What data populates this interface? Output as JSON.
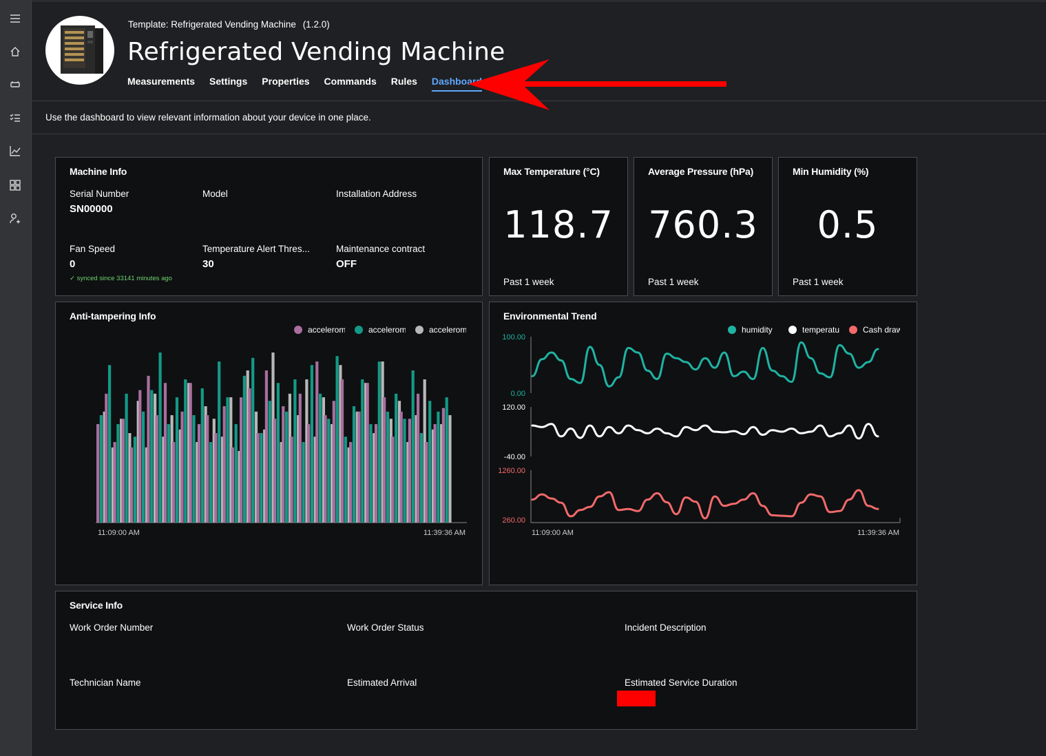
{
  "rail": {
    "icons": [
      "hamburger-icon",
      "home-icon",
      "device-icon",
      "rules-icon",
      "analytics-icon",
      "dashboard-icon",
      "admin-icon"
    ]
  },
  "header": {
    "template_prefix": "Template:",
    "template_name": "Refrigerated Vending Machine",
    "template_version": "(1.2.0)",
    "title": "Refrigerated Vending Machine",
    "tabs": [
      {
        "label": "Measurements"
      },
      {
        "label": "Settings"
      },
      {
        "label": "Properties"
      },
      {
        "label": "Commands"
      },
      {
        "label": "Rules"
      },
      {
        "label": "Dashboard",
        "active": true
      }
    ]
  },
  "description": "Use the dashboard to view relevant information about your device in one place.",
  "machine_info": {
    "title": "Machine Info",
    "serial_label": "Serial Number",
    "serial_value": "SN00000",
    "model_label": "Model",
    "address_label": "Installation Address",
    "fan_label": "Fan Speed",
    "fan_value": "0",
    "synced_text": "✓ synced since 33141 minutes ago",
    "temp_alert_label": "Temperature Alert Thres...",
    "temp_alert_value": "30",
    "maintenance_label": "Maintenance contract",
    "maintenance_value": "OFF"
  },
  "kpis": [
    {
      "title": "Max Temperature (°C)",
      "value": "118.7",
      "period": "Past 1 week"
    },
    {
      "title": "Average Pressure (hPa)",
      "value": "760.3",
      "period": "Past 1 week"
    },
    {
      "title": "Min Humidity (%)",
      "value": "0.5",
      "period": "Past 1 week"
    }
  ],
  "colors": {
    "accent": "#5fa8ff",
    "magenta": "#a86e9e",
    "teal": "#139a86",
    "grey": "#b8b8b8",
    "humidity": "#1fb3a3",
    "temperature": "#ffffff",
    "cash": "#f26a6a",
    "arrow": "#ff0000"
  },
  "anti_tamper": {
    "title": "Anti-tampering Info",
    "legend": [
      "acceleromet",
      "acceleromet",
      "acceleromet"
    ],
    "x_start": "11:09:00 AM",
    "x_end": "11:39:36 AM"
  },
  "env_trend": {
    "title": "Environmental Trend",
    "legend": [
      "humidity",
      "temperature",
      "Cash drawer"
    ],
    "x_start": "11:09:00 AM",
    "x_end": "11:39:36 AM",
    "humidity_max": "100.00",
    "humidity_min": "0.00",
    "temp_max": "120.00",
    "temp_min": "-40.00",
    "cash_max": "1260.00",
    "cash_min": "260.00"
  },
  "service_info": {
    "title": "Service Info",
    "work_order_number": "Work Order Number",
    "work_order_status": "Work Order Status",
    "incident_description": "Incident Description",
    "technician_name": "Technician Name",
    "estimated_arrival": "Estimated Arrival",
    "estimated_duration": "Estimated Service Duration"
  },
  "chart_data": [
    {
      "type": "bar",
      "title": "Anti-tampering Info",
      "x": [
        "11:09:00 AM",
        "11:39:36 AM"
      ],
      "series": [
        {
          "name": "acceleromet",
          "values": [
            0.55,
            0.72,
            0.45,
            0.58,
            0.42,
            0.74,
            0.82,
            0.6,
            0.78,
            0.45,
            0.62,
            0.78,
            0.55,
            0.6,
            0.5,
            0.65,
            0.42,
            0.7,
            0.75,
            0.5,
            0.85,
            0.58,
            0.65,
            0.48,
            0.72,
            0.55,
            0.9,
            0.6,
            0.68,
            0.8,
            0.45,
            0.62,
            0.78,
            0.55,
            0.7,
            0.48,
            0.62,
            0.58,
            0.72,
            0.45,
            0.55,
            0.64
          ]
        },
        {
          "name": "acceleromet",
          "values": [
            0.6,
            0.88,
            0.55,
            0.72,
            0.48,
            0.62,
            0.74,
            0.95,
            0.55,
            0.7,
            0.8,
            0.6,
            0.75,
            0.45,
            0.9,
            0.7,
            0.55,
            0.82,
            0.92,
            0.5,
            0.68,
            0.78,
            0.62,
            0.8,
            0.45,
            0.88,
            0.72,
            0.58,
            0.93,
            0.48,
            0.65,
            0.8,
            0.55,
            0.9,
            0.62,
            0.72,
            0.58,
            0.85,
            0.5,
            0.68,
            0.62,
            0.7
          ]
        },
        {
          "name": "acceleromet",
          "values": [
            0.62,
            0.42,
            0.58,
            0.5,
            0.68,
            0.42,
            0.72,
            0.48,
            0.6,
            0.52,
            0.78,
            0.45,
            0.65,
            0.58,
            0.48,
            0.7,
            0.4,
            0.85,
            0.62,
            0.52,
            0.95,
            0.45,
            0.72,
            0.6,
            0.8,
            0.48,
            0.7,
            0.55,
            0.88,
            0.42,
            0.62,
            0.78,
            0.5,
            0.9,
            0.58,
            0.68,
            0.45,
            0.6,
            0.8,
            0.52,
            0.55,
            0.6
          ]
        }
      ]
    },
    {
      "type": "line",
      "title": "Environmental Trend",
      "x": [
        "11:09:00 AM",
        "11:39:36 AM"
      ],
      "series": [
        {
          "name": "humidity",
          "ylim": [
            0,
            100
          ],
          "values": [
            30,
            60,
            72,
            58,
            25,
            18,
            82,
            50,
            12,
            28,
            80,
            72,
            40,
            25,
            70,
            62,
            55,
            42,
            62,
            45,
            72,
            30,
            38,
            25,
            80,
            40,
            30,
            20,
            90,
            62,
            35,
            28,
            85,
            70,
            45,
            55,
            78
          ]
        },
        {
          "name": "temperature",
          "ylim": [
            -40,
            120
          ],
          "values": [
            60,
            55,
            65,
            25,
            50,
            20,
            60,
            25,
            55,
            35,
            60,
            45,
            35,
            50,
            35,
            25,
            55,
            45,
            60,
            40,
            38,
            42,
            32,
            55,
            30,
            45,
            40,
            50,
            35,
            40,
            60,
            25,
            35,
            60,
            18,
            65,
            25
          ]
        },
        {
          "name": "Cash drawer",
          "ylim": [
            260,
            1260
          ],
          "values": [
            700,
            800,
            720,
            640,
            380,
            500,
            560,
            760,
            840,
            500,
            520,
            480,
            700,
            820,
            650,
            420,
            740,
            660,
            340,
            760,
            580,
            620,
            700,
            820,
            580,
            400,
            390,
            380,
            640,
            800,
            760,
            460,
            480,
            700,
            880,
            580,
            520
          ]
        }
      ]
    }
  ]
}
